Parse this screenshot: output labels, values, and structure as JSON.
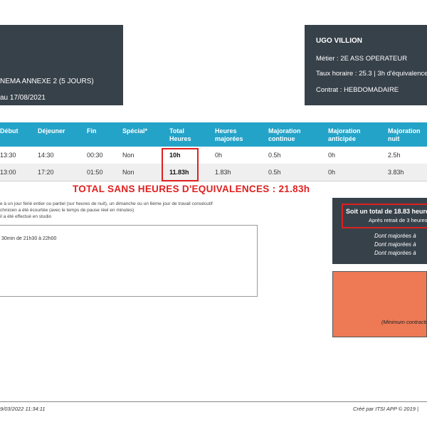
{
  "header_left": {
    "line1": "NEMA ANNEXE 2 (5 JOURS)",
    "line2": "au 17/08/2021"
  },
  "header_right": {
    "name": "UGO VILLION",
    "metier": "Métier : 2E ASS OPERATEUR",
    "taux": "Taux horaire : 25.3 | 3h d'équivalence",
    "contrat": "Contrat : HEBDOMADAIRE"
  },
  "table": {
    "headers": [
      "Début",
      "Déjeuner",
      "Fin",
      "Spécial*",
      "Total Heures",
      "Heures majorées",
      "Majoration continue",
      "Majoration anticipée",
      "Majoration nuit"
    ],
    "rows": [
      [
        "13:30",
        "14:30",
        "00:30",
        "Non",
        "10h",
        "0h",
        "0.5h",
        "0h",
        "2.5h"
      ],
      [
        "13:00",
        "17:20",
        "01:50",
        "Non",
        "11.83h",
        "1.83h",
        "0.5h",
        "0h",
        "3.83h"
      ]
    ]
  },
  "total_sans": "TOTAL SANS HEURES D'EQUIVALENCES : 21.83h",
  "notes": [
    "e à un jour férié entier ou partiel (sur heures de nuit), un dimanche ou un 6ème jour de travail consécutif",
    "chnicien a été écourtée (avec le temps de pause réel en minutes)",
    "il a été effectué en studio"
  ],
  "note_box_text": "30min de 21h30 à 22h00",
  "summary": {
    "total": "Soit un total de 18.83 heures",
    "retrait": "Après retrait de 3 heures",
    "lines": [
      "Dont majorées à",
      "Dont majorées à",
      "Dont majorées à"
    ]
  },
  "orange_text": "(Minimum contractuel",
  "footer_left": "9/03/2022 11:34:11",
  "footer_right": "Créé par ITSI APP © 2019 |",
  "colors": {
    "dark": "#37414a",
    "table_header": "#24a3c8",
    "accent_red": "#e02020",
    "orange": "#ee7a55"
  }
}
